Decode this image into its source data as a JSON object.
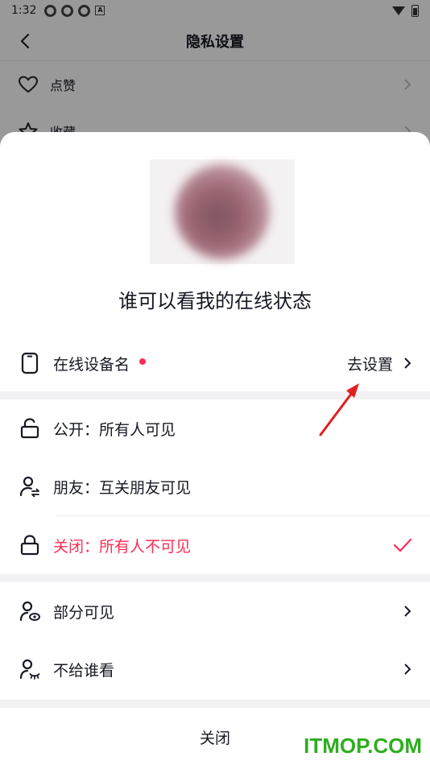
{
  "status_bar": {
    "time": "1:32"
  },
  "background_page": {
    "title": "隐私设置",
    "rows": [
      {
        "label": "点赞",
        "icon": "heart-icon"
      },
      {
        "label": "收藏",
        "icon": "star-icon"
      }
    ]
  },
  "sheet": {
    "title": "谁可以看我的在线状态",
    "device_row": {
      "label": "在线设备名",
      "action": "去设置",
      "icon": "phone-icon"
    },
    "options": [
      {
        "label": "公开：所有人可见",
        "icon": "unlock-icon",
        "selected": false
      },
      {
        "label": "朋友：互关朋友可见",
        "icon": "friends-icon",
        "selected": false
      },
      {
        "label": "关闭：所有人不可见",
        "icon": "lock-icon",
        "selected": true
      }
    ],
    "extra_rows": [
      {
        "label": "部分可见",
        "icon": "user-eye-icon"
      },
      {
        "label": "不给谁看",
        "icon": "user-hidden-icon"
      }
    ],
    "close_label": "关闭"
  },
  "colors": {
    "accent": "#fe2c55",
    "arrow": "#e02020",
    "watermark": "#2dae1f"
  },
  "watermark": "ITMOP.COM"
}
